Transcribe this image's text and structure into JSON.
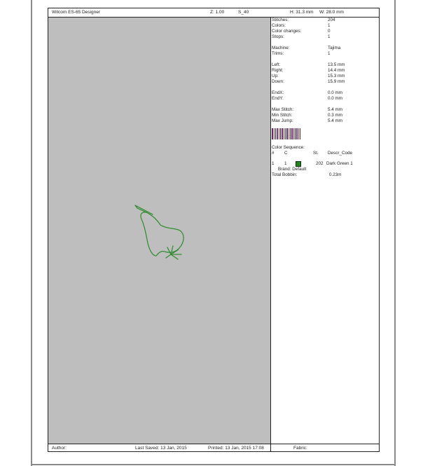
{
  "header": {
    "app_title": "Wilcom ES-65 Designer",
    "zoom": "Z: 1.00",
    "design_name": "S_40",
    "height": "H: 31.3 mm",
    "width": "W: 28.0 mm"
  },
  "stats": {
    "stitches_label": "Stitches:",
    "stitches": "204",
    "colors_label": "Colors:",
    "colors": "1",
    "color_changes_label": "Color changes:",
    "color_changes": "0",
    "stops_label": "Stops:",
    "stops": "1",
    "machine_label": "Machine:",
    "machine": "Tajima",
    "trims_label": "Trims:",
    "trims": "1",
    "left_label": "Left:",
    "left": "13.5 mm",
    "right_label": "Right:",
    "right": "14.4 mm",
    "up_label": "Up:",
    "up": "15.3 mm",
    "down_label": "Down:",
    "down": "15.9 mm",
    "endx_label": "EndX:",
    "endx": "0.0 mm",
    "endy_label": "EndY:",
    "endy": "0.0 mm",
    "max_stitch_label": "Max Stitch:",
    "max_stitch": "5.4 mm",
    "min_stitch_label": "Min Stitch:",
    "min_stitch": "0.3 mm",
    "max_jump_label": "Max Jump:",
    "max_jump": "5.4 mm"
  },
  "sequence": {
    "title": "Color Sequence:",
    "col_num": "#",
    "col_c": "C",
    "col_st": "St.",
    "col_descr": "Descr_Code",
    "rows": [
      {
        "num": "1",
        "c": "1",
        "st": "202",
        "descr": "Dark Green 1",
        "brand": "Brand: Default",
        "color": "#1a8a1a"
      }
    ],
    "bobbin_label": "Total Bobbin:",
    "bobbin_value": "0.23m"
  },
  "footer": {
    "author": "Author:",
    "last_saved": "Last Saved: 13 Jan, 2015",
    "printed": "Printed: 13 Jan, 2015 17:08",
    "fabric": "Fabric:"
  },
  "colors": {
    "thread": "#2e8b2e",
    "canvas": "#bebebe"
  }
}
